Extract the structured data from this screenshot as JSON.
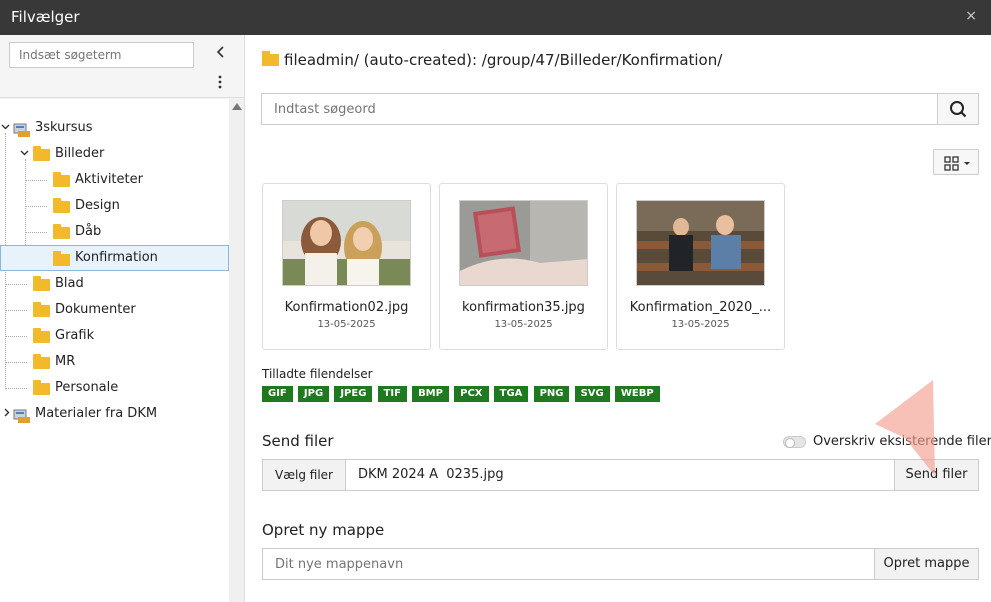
{
  "window": {
    "title": "Filvælger",
    "close_symbol": "×"
  },
  "sidebar": {
    "search_placeholder": "Indsæt søgeterm",
    "tree": [
      {
        "label": "3skursus",
        "level": 0,
        "expanded": true
      },
      {
        "label": "Billeder",
        "level": 1,
        "expanded": true
      },
      {
        "label": "Aktiviteter",
        "level": 2
      },
      {
        "label": "Design",
        "level": 2
      },
      {
        "label": "Dåb",
        "level": 2
      },
      {
        "label": "Konfirmation",
        "level": 2,
        "selected": true
      },
      {
        "label": "Blad",
        "level": 1
      },
      {
        "label": "Dokumenter",
        "level": 1
      },
      {
        "label": "Grafik",
        "level": 1
      },
      {
        "label": "MR",
        "level": 1
      },
      {
        "label": "Personale",
        "level": 1
      },
      {
        "label": "Materialer fra DKM",
        "level": 0,
        "expanded": false
      }
    ]
  },
  "main": {
    "path": "fileadmin/ (auto-created): /group/47/Billeder/Konfirmation/",
    "search_placeholder": "Indtast søgeord",
    "files": [
      {
        "name": "Konfirmation02.jpg",
        "date": "13-05-2025"
      },
      {
        "name": "konfirmation35.jpg",
        "date": "13-05-2025"
      },
      {
        "name": "Konfirmation_2020_...",
        "date": "13-05-2025"
      }
    ],
    "allowed_label": "Tilladte filendelser",
    "allowed_extensions": [
      "GIF",
      "JPG",
      "JPEG",
      "TIF",
      "BMP",
      "PCX",
      "TGA",
      "PNG",
      "SVG",
      "WEBP"
    ],
    "upload": {
      "title": "Send filer",
      "overwrite_label": "Overskriv eksisterende filer",
      "choose_label": "Vælg filer",
      "filename": "DKM 2024 A  0235.jpg",
      "send_label": "Send filer"
    },
    "new_folder": {
      "title": "Opret ny mappe",
      "placeholder": "Dit nye mappenavn",
      "create_label": "Opret mappe"
    }
  },
  "colors": {
    "accent_badge": "#1f7a1f",
    "folder": "#f2b92c",
    "titlebar": "#383838"
  }
}
